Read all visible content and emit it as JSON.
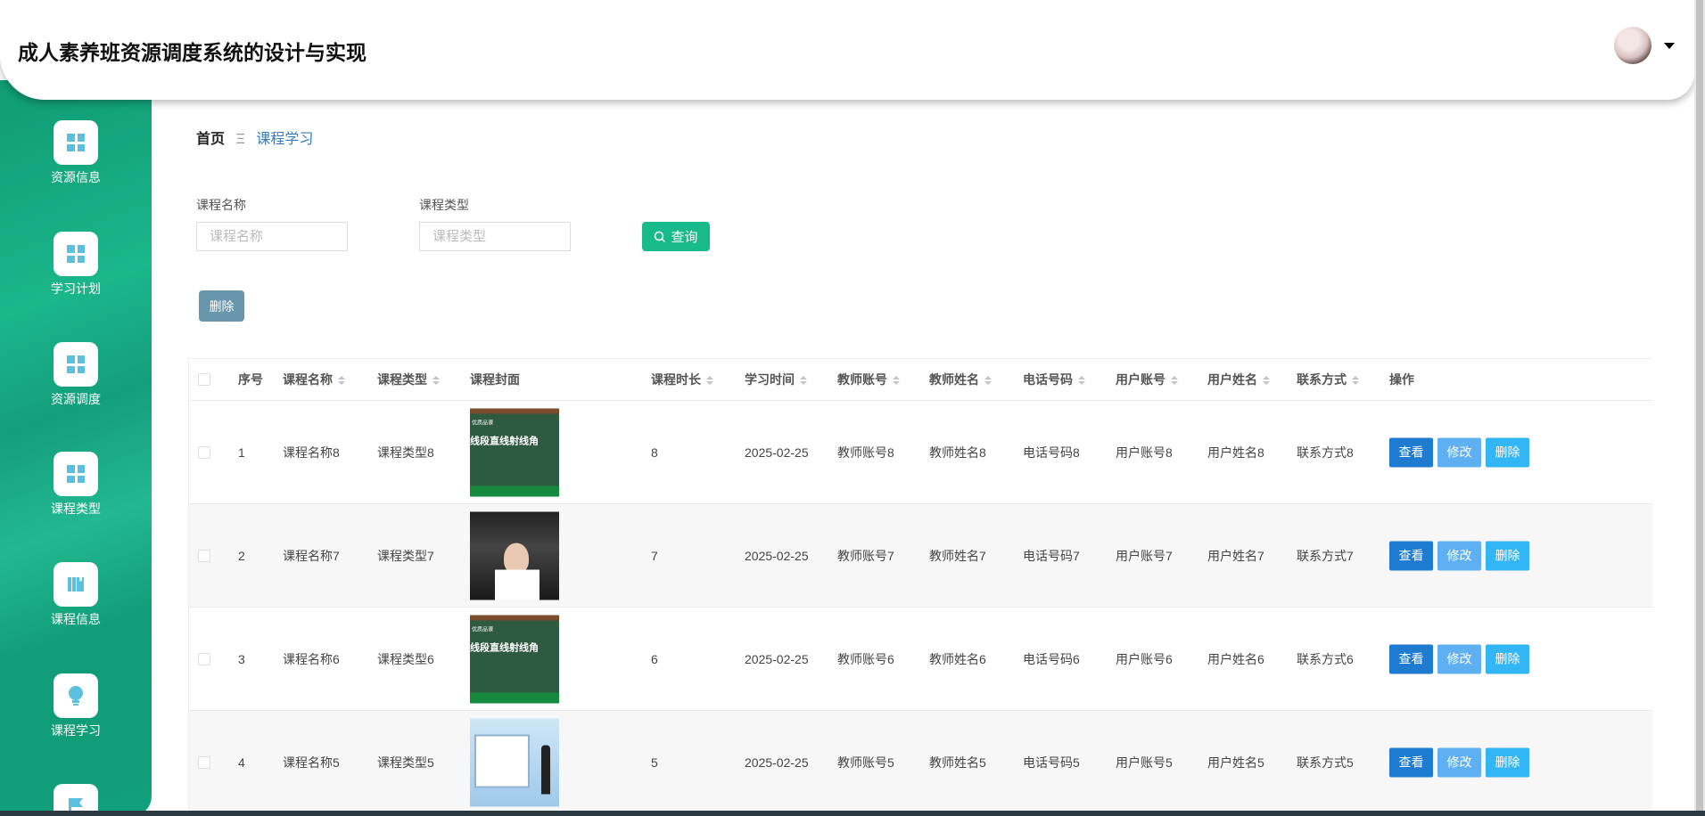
{
  "header": {
    "title": "成人素养班资源调度系统的设计与实现",
    "avatar": "user-avatar"
  },
  "sidebar": {
    "items": [
      {
        "label": "资源信息",
        "icon": "grid-icon"
      },
      {
        "label": "学习计划",
        "icon": "grid-icon"
      },
      {
        "label": "资源调度",
        "icon": "grid-icon"
      },
      {
        "label": "课程类型",
        "icon": "grid-icon"
      },
      {
        "label": "课程信息",
        "icon": "book-icon"
      },
      {
        "label": "课程学习",
        "icon": "bulb-icon"
      },
      {
        "label": "",
        "icon": "flag-icon"
      }
    ]
  },
  "breadcrumb": {
    "home": "首页",
    "separator": "Ξ",
    "current": "课程学习"
  },
  "search": {
    "name_label": "课程名称",
    "name_placeholder": "课程名称",
    "name_value": "",
    "type_label": "课程类型",
    "type_placeholder": "课程类型",
    "type_value": "",
    "button": "查询"
  },
  "toolbar": {
    "delete": "删除"
  },
  "table": {
    "columns": [
      "序号",
      "课程名称",
      "课程类型",
      "课程封面",
      "课程时长",
      "学习时间",
      "教师账号",
      "教师姓名",
      "电话号码",
      "用户账号",
      "用户姓名",
      "联系方式",
      "操作"
    ],
    "actions": {
      "view": "查看",
      "edit": "修改",
      "delete": "删除"
    },
    "rows": [
      {
        "no": "1",
        "name": "课程名称8",
        "type": "课程类型8",
        "cover": "board",
        "cover_title": "线段直线射线角",
        "duration": "8",
        "date": "2025-02-25",
        "teacher_acc": "教师账号8",
        "teacher_name": "教师姓名8",
        "phone": "电话号码8",
        "user_acc": "用户账号8",
        "user_name": "用户姓名8",
        "contact": "联系方式8"
      },
      {
        "no": "2",
        "name": "课程名称7",
        "type": "课程类型7",
        "cover": "photo",
        "cover_title": "",
        "duration": "7",
        "date": "2025-02-25",
        "teacher_acc": "教师账号7",
        "teacher_name": "教师姓名7",
        "phone": "电话号码7",
        "user_acc": "用户账号7",
        "user_name": "用户姓名7",
        "contact": "联系方式7"
      },
      {
        "no": "3",
        "name": "课程名称6",
        "type": "课程类型6",
        "cover": "board",
        "cover_title": "线段直线射线角",
        "duration": "6",
        "date": "2025-02-25",
        "teacher_acc": "教师账号6",
        "teacher_name": "教师姓名6",
        "phone": "电话号码6",
        "user_acc": "用户账号6",
        "user_name": "用户姓名6",
        "contact": "联系方式6"
      },
      {
        "no": "4",
        "name": "课程名称5",
        "type": "课程类型5",
        "cover": "wb",
        "cover_title": "",
        "duration": "5",
        "date": "2025-02-25",
        "teacher_acc": "教师账号5",
        "teacher_name": "教师姓名5",
        "phone": "电话号码5",
        "user_acc": "用户账号5",
        "user_name": "用户姓名5",
        "contact": "联系方式5"
      }
    ]
  },
  "colors": {
    "sidebar": "#16a07a",
    "search": "#18b98a",
    "view": "#1e7bd0",
    "edit": "#5eb0f2",
    "delete": "#33b6f5",
    "batch_delete": "#6896ad"
  }
}
